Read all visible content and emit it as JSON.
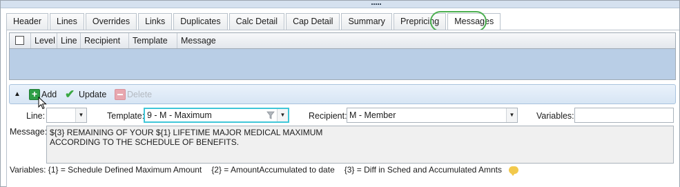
{
  "tabs": [
    {
      "label": "Header"
    },
    {
      "label": "Lines"
    },
    {
      "label": "Overrides"
    },
    {
      "label": "Links"
    },
    {
      "label": "Duplicates"
    },
    {
      "label": "Calc Detail"
    },
    {
      "label": "Cap Detail"
    },
    {
      "label": "Summary"
    },
    {
      "label": "Prepricing"
    },
    {
      "label": "Messages"
    }
  ],
  "active_tab": "Messages",
  "grid": {
    "columns": [
      "Level",
      "Line",
      "Recipient",
      "Template",
      "Message"
    ],
    "rows": []
  },
  "toolbar": {
    "add_label": "Add",
    "update_label": "Update",
    "delete_label": "Delete"
  },
  "form": {
    "line_label": "Line:",
    "line_value": "",
    "template_label": "Template:",
    "template_value": "9 - M - Maximum",
    "recipient_label": "Recipient:",
    "recipient_value": "M - Member",
    "variables_label": "Variables:",
    "variables_value": "",
    "message_label": "Message:",
    "message_lines": [
      "${3} REMAINING OF YOUR ${1} LIFETIME MAJOR MEDICAL MAXIMUM",
      "ACCORDING TO THE SCHEDULE OF BENEFITS."
    ]
  },
  "variables_legend": [
    "Variables: {1} = Schedule Defined Maximum Amount",
    "{2} = AmountAccumulated to date",
    "{3} = Diff in Sched and Accumulated Amnts"
  ],
  "colors": {
    "grid_background": "#b9cee6",
    "highlight_ring": "#4caf50",
    "focus_border": "#3fc6d8",
    "add_icon": "#2e9e46",
    "update_icon": "#3aa843",
    "delete_icon_disabled": "#e8a8b0"
  },
  "icons": {
    "collapse": "chevron-up-icon",
    "add": "plus-icon",
    "update": "checkmark-icon",
    "delete": "minus-icon",
    "template_filter": "filter-icon",
    "variables_info": "speech-bubble-icon"
  }
}
